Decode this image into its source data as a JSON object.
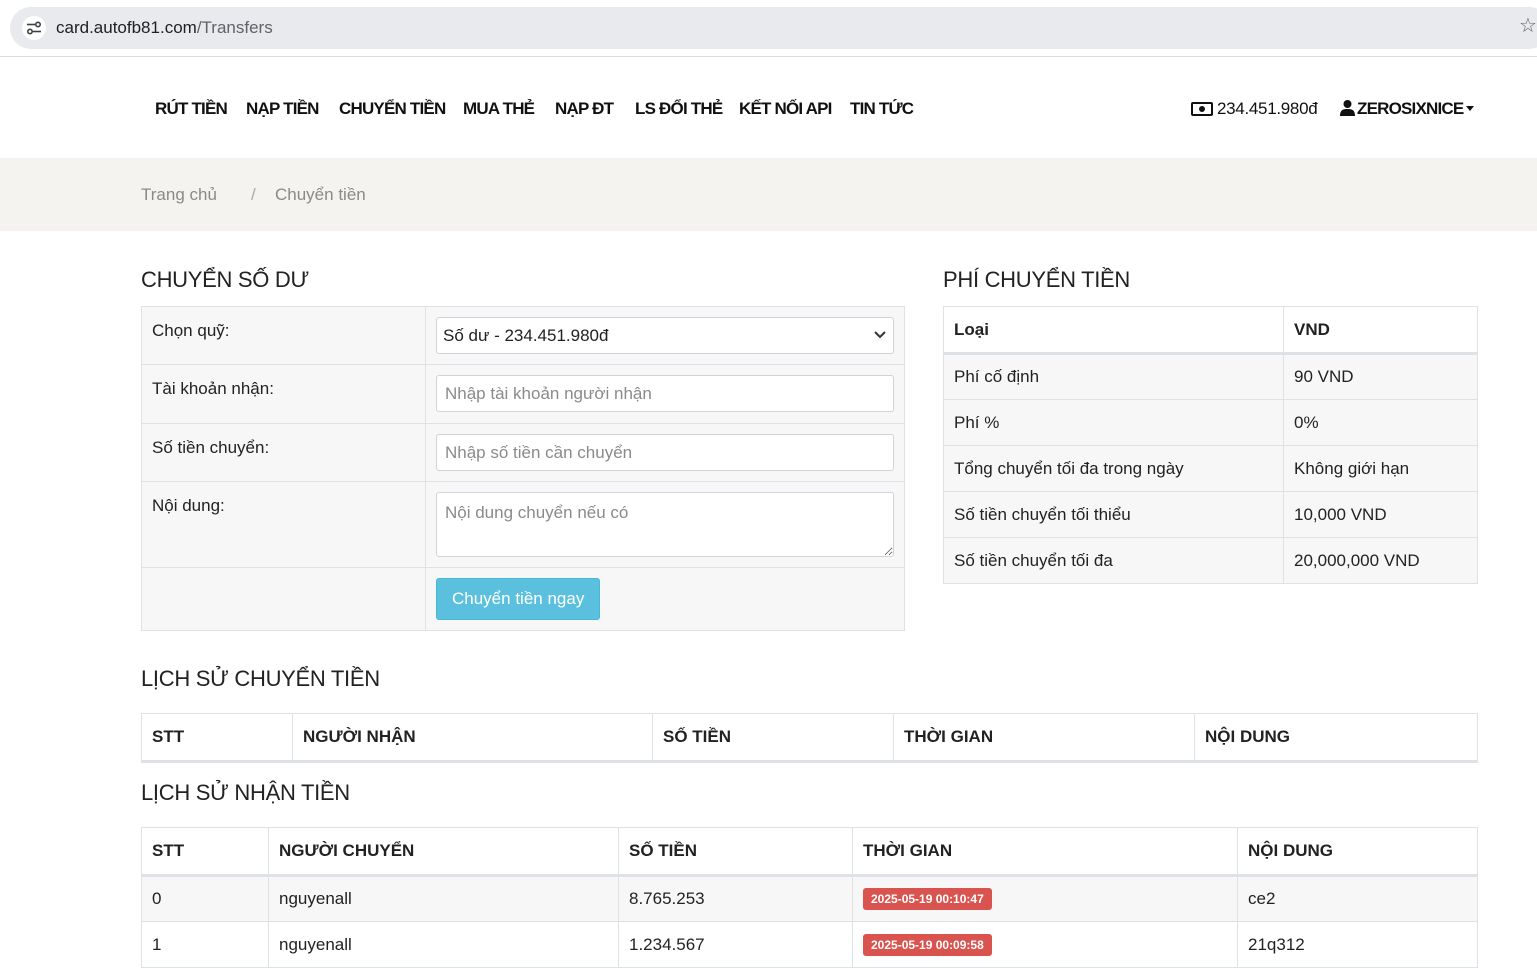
{
  "browser": {
    "url_host": "card.autofb81.com",
    "url_path": "/Transfers"
  },
  "nav": {
    "items": [
      "RÚT TIỀN",
      "NẠP TIỀN",
      "CHUYỂN TIỀN",
      "MUA THẺ",
      "NẠP ĐT",
      "LS ĐỔI THẺ",
      "KẾT NỐI API",
      "TIN TỨC"
    ],
    "balance": "234.451.980đ",
    "username": "ZEROSIXNICE"
  },
  "breadcrumb": {
    "home": "Trang chủ",
    "separator": "/",
    "current": "Chuyển tiền"
  },
  "transfer_form": {
    "title": "CHUYỂN SỐ DƯ",
    "fund_label": "Chọn quỹ:",
    "fund_value": "Số dư - 234.451.980đ",
    "recipient_label": "Tài khoản nhận:",
    "recipient_placeholder": "Nhập tài khoản người nhận",
    "amount_label": "Số tiền chuyển:",
    "amount_placeholder": "Nhập số tiền cần chuyển",
    "content_label": "Nội dung:",
    "content_placeholder": "Nội dung chuyển nếu có",
    "submit_label": "Chuyển tiền ngay"
  },
  "fee_table": {
    "title": "PHÍ CHUYỂN TIỀN",
    "headers": [
      "Loại",
      "VND"
    ],
    "rows": [
      [
        "Phí cố định",
        "90 VND"
      ],
      [
        "Phí %",
        "0%"
      ],
      [
        "Tổng chuyển tối đa trong ngày",
        "Không giới hạn"
      ],
      [
        "Số tiền chuyển tối thiểu",
        "10,000 VND"
      ],
      [
        "Số tiền chuyển tối đa",
        "20,000,000 VND"
      ]
    ]
  },
  "sent_history": {
    "title": "LỊCH SỬ CHUYỂN TIỀN",
    "headers": [
      "STT",
      "NGƯỜI NHẬN",
      "SỐ TIỀN",
      "THỜI GIAN",
      "NỘI DUNG"
    ]
  },
  "received_history": {
    "title": "LỊCH SỬ NHẬN TIỀN",
    "headers": [
      "STT",
      "NGƯỜI CHUYỂN",
      "SỐ TIỀN",
      "THỜI GIAN",
      "NỘI DUNG"
    ],
    "rows": [
      {
        "stt": "0",
        "sender": "nguyenall",
        "amount": "8.765.253",
        "time": "2025-05-19 00:10:47",
        "content": "ce2"
      },
      {
        "stt": "1",
        "sender": "nguyenall",
        "amount": "1.234.567",
        "time": "2025-05-19 00:09:58",
        "content": "21q312"
      }
    ]
  },
  "colors": {
    "button": "#5bc0de",
    "time_badge": "#d9534f",
    "breadcrumb_bg": "#f4f3ef"
  }
}
